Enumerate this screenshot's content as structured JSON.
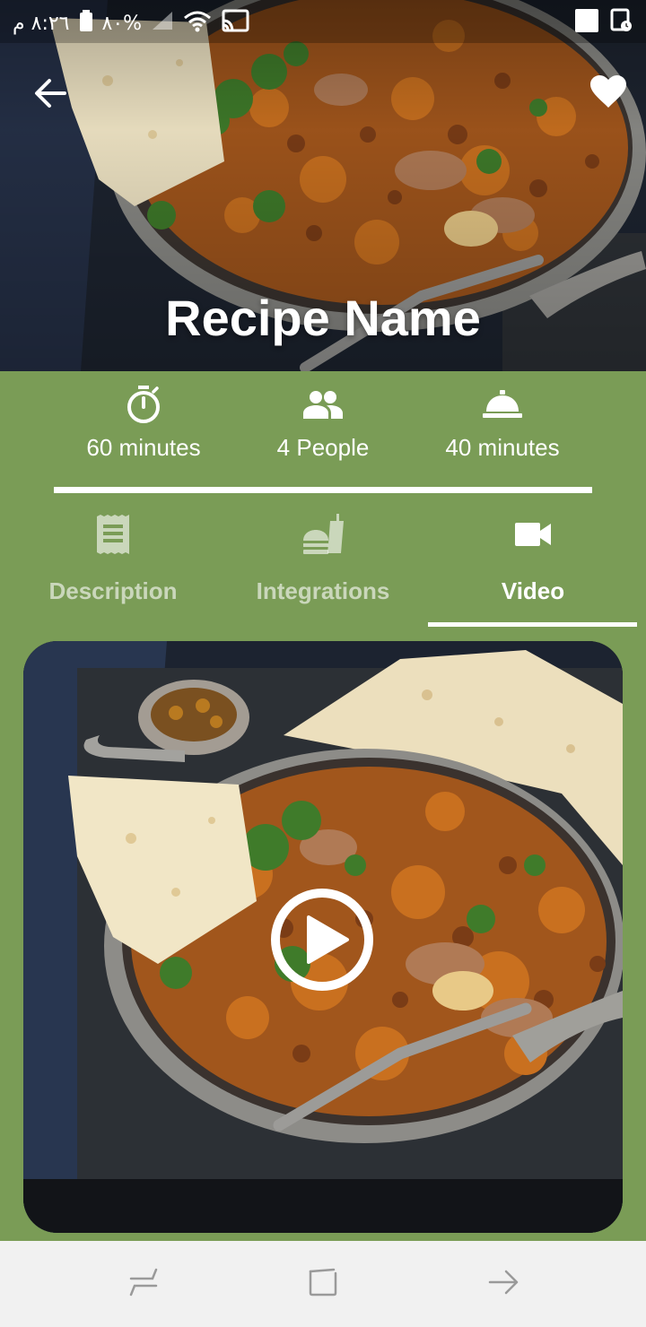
{
  "status_bar": {
    "time": "٨:٢٦ م",
    "battery": "%٨٠",
    "icons": [
      "battery-icon",
      "signal-icon",
      "wifi-icon",
      "cast-icon",
      "square-notification-icon",
      "clock-notification-icon"
    ]
  },
  "header": {
    "title": "Recipe Name",
    "back_icon": "arrow-left-icon",
    "favorite_icon": "heart-icon"
  },
  "info": [
    {
      "icon": "timer-icon",
      "label": "60 minutes"
    },
    {
      "icon": "people-icon",
      "label": "4 People"
    },
    {
      "icon": "room-service-bell-icon",
      "label": "40 minutes"
    }
  ],
  "tabs": [
    {
      "icon": "receipt-icon",
      "label": "Description",
      "active": false
    },
    {
      "icon": "fastfood-icon",
      "label": "Integrations",
      "active": false
    },
    {
      "icon": "videocam-icon",
      "label": "Video",
      "active": true
    }
  ],
  "video": {
    "play_icon": "play-circle-icon"
  },
  "colors": {
    "background": "#7a9c56",
    "text": "#ffffff",
    "inactive_tab_text": "rgba(255,255,255,0.6)",
    "nav_bar": "#f1f1f1"
  },
  "nav_bar": {
    "icons": [
      "recents-icon",
      "home-icon",
      "back-icon"
    ]
  }
}
